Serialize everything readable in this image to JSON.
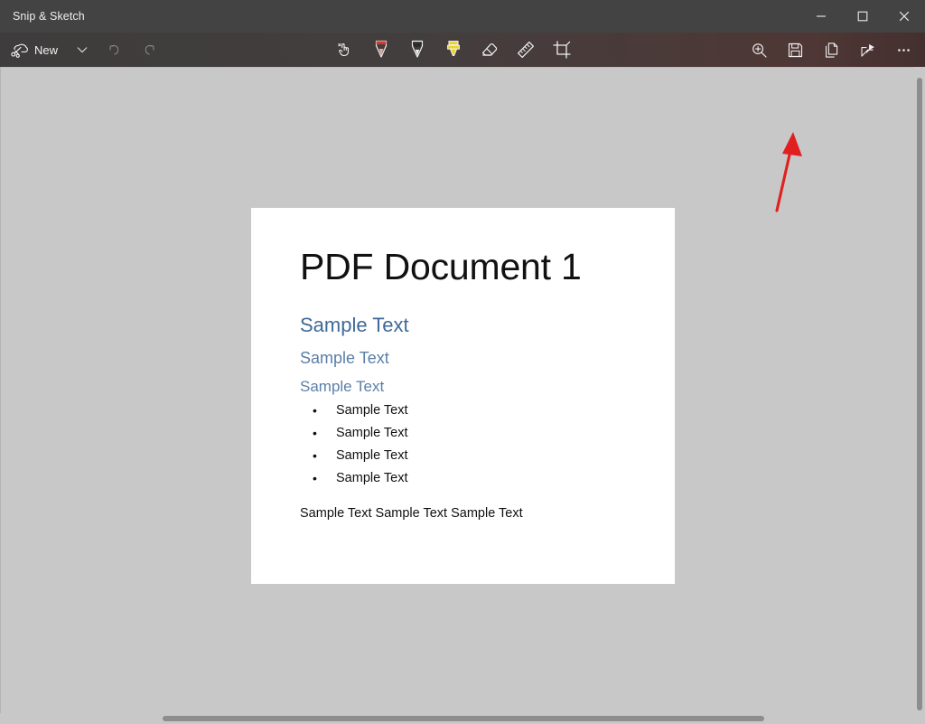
{
  "window": {
    "app_title": "Snip & Sketch",
    "controls": [
      {
        "name": "minimize",
        "label": "Minimize"
      },
      {
        "name": "maximize",
        "label": "Maximize"
      },
      {
        "name": "close",
        "label": "Close"
      }
    ]
  },
  "toolbar": {
    "new_label": "New",
    "new_icon": "snip-new-icon",
    "dropdown_icon": "chevron-down-icon",
    "undo_icon": "undo-icon",
    "redo_icon": "redo-icon",
    "tools": [
      {
        "name": "touch-writing",
        "icon": "touch-writing-icon",
        "selected": false,
        "color": "#f0f0f0"
      },
      {
        "name": "ballpoint-pen",
        "icon": "ballpoint-pen-icon",
        "selected": false,
        "color": "#d23a2e"
      },
      {
        "name": "pencil",
        "icon": "pencil-icon",
        "selected": false,
        "color": "#2b2b2b"
      },
      {
        "name": "highlighter",
        "icon": "highlighter-icon",
        "selected": true,
        "color": "#e8d32a"
      },
      {
        "name": "eraser",
        "icon": "eraser-icon",
        "selected": false,
        "color": "#f0f0f0"
      },
      {
        "name": "ruler",
        "icon": "ruler-icon",
        "selected": false,
        "color": "#f0f0f0"
      },
      {
        "name": "crop",
        "icon": "crop-icon",
        "selected": false,
        "color": "#f0f0f0"
      }
    ],
    "actions": [
      {
        "name": "zoom",
        "icon": "zoom-in-icon"
      },
      {
        "name": "save",
        "icon": "save-icon"
      },
      {
        "name": "copy",
        "icon": "copy-icon"
      },
      {
        "name": "share",
        "icon": "share-icon"
      },
      {
        "name": "see-more",
        "icon": "ellipsis-icon"
      }
    ]
  },
  "document": {
    "title": "PDF Document 1",
    "heading_1": "Sample Text",
    "heading_2": "Sample Text",
    "heading_3": "Sample Text",
    "bullets": [
      "Sample Text",
      "Sample Text",
      "Sample Text",
      "Sample Text"
    ],
    "paragraph": "Sample Text Sample Text Sample Text"
  },
  "annotation": {
    "type": "arrow",
    "color": "#e02020",
    "points_to": "save-button"
  },
  "colors": {
    "titlebar": "#434343",
    "toolbar_left": "#3e3c3c",
    "toolbar_right": "#44302f",
    "canvas": "#c8c8c8",
    "page": "#ffffff",
    "heading_blue": "#5b7fa8",
    "annotation_red": "#e02020",
    "highlighter_yellow": "#e8d32a",
    "pen_red": "#d23a2e"
  }
}
